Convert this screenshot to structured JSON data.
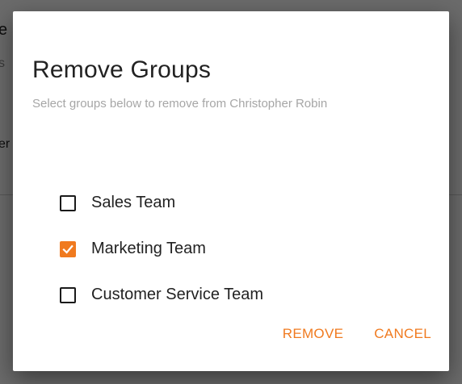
{
  "background": {
    "fragment_top": "e",
    "fragment_mid": "s",
    "fragment_low": "er"
  },
  "dialog": {
    "title": "Remove Groups",
    "subtitle": "Select groups below to remove from Christopher Robin",
    "groups": [
      {
        "label": "Sales Team",
        "checked": false
      },
      {
        "label": "Marketing Team",
        "checked": true
      },
      {
        "label": "Customer Service Team",
        "checked": false
      }
    ],
    "actions": {
      "remove_label": "REMOVE",
      "cancel_label": "CANCEL"
    }
  },
  "colors": {
    "accent": "#f07a1f",
    "title": "#222222",
    "subtitle": "#a6a6a6",
    "overlay": "rgba(0,0,0,0.58)"
  },
  "icons": {
    "checkbox_checked": "checkmark-icon"
  }
}
